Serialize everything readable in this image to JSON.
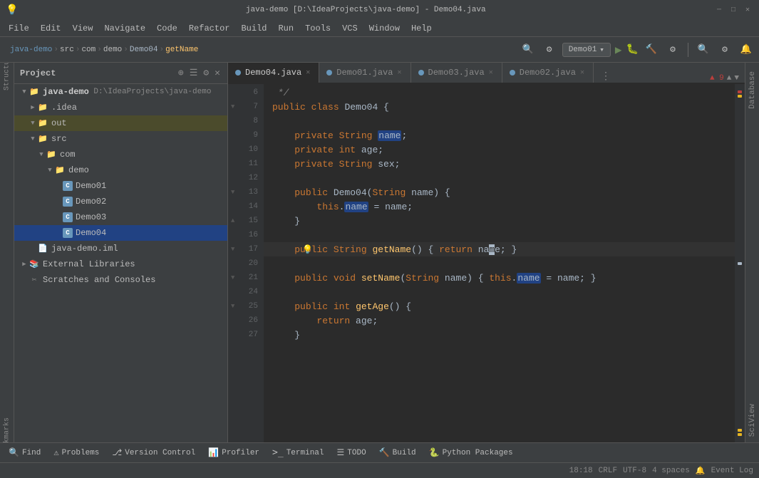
{
  "titleBar": {
    "title": "java-demo [D:\\IdeaProjects\\java-demo] - Demo04.java",
    "minBtn": "─",
    "maxBtn": "□",
    "closeBtn": "✕"
  },
  "menuBar": {
    "items": [
      "File",
      "Edit",
      "View",
      "Navigate",
      "Code",
      "Refactor",
      "Build",
      "Run",
      "Tools",
      "VCS",
      "Window",
      "Help"
    ]
  },
  "toolbar": {
    "projectName": "java-demo",
    "breadcrumb": {
      "parts": [
        "java-demo",
        "src",
        "com",
        "demo",
        "Demo04",
        "getName"
      ]
    },
    "runConfig": "Demo01"
  },
  "projectPanel": {
    "title": "Project",
    "tree": [
      {
        "indent": 0,
        "arrow": "▼",
        "icon": "📁",
        "label": "java-demo",
        "sublabel": "D:\\IdeaProjects\\java-demo",
        "type": "root"
      },
      {
        "indent": 1,
        "arrow": "▶",
        "icon": "📁",
        "label": ".idea",
        "type": "folder"
      },
      {
        "indent": 1,
        "arrow": "▼",
        "icon": "📁",
        "label": "out",
        "type": "folder-selected"
      },
      {
        "indent": 1,
        "arrow": "▼",
        "icon": "📁",
        "label": "src",
        "type": "src"
      },
      {
        "indent": 2,
        "arrow": "▼",
        "icon": "📁",
        "label": "com",
        "type": "folder"
      },
      {
        "indent": 3,
        "arrow": "▼",
        "icon": "📁",
        "label": "demo",
        "type": "folder"
      },
      {
        "indent": 4,
        "arrow": "",
        "icon": "C",
        "label": "Demo01",
        "type": "java"
      },
      {
        "indent": 4,
        "arrow": "",
        "icon": "C",
        "label": "Demo02",
        "type": "java"
      },
      {
        "indent": 4,
        "arrow": "",
        "icon": "C",
        "label": "Demo03",
        "type": "java"
      },
      {
        "indent": 4,
        "arrow": "",
        "icon": "C",
        "label": "Demo04",
        "type": "java"
      },
      {
        "indent": 1,
        "arrow": "",
        "icon": "📄",
        "label": "java-demo.iml",
        "type": "iml"
      },
      {
        "indent": 0,
        "arrow": "▶",
        "icon": "📚",
        "label": "External Libraries",
        "type": "lib"
      },
      {
        "indent": 0,
        "arrow": "",
        "icon": "✂",
        "label": "Scratches and Consoles",
        "type": "scratches"
      }
    ]
  },
  "tabs": [
    {
      "label": "Demo04.java",
      "active": true,
      "modified": false
    },
    {
      "label": "Demo01.java",
      "active": false,
      "modified": false
    },
    {
      "label": "Demo03.java",
      "active": false,
      "modified": false
    },
    {
      "label": "Demo02.java",
      "active": false,
      "modified": false
    }
  ],
  "codeLines": [
    {
      "num": 6,
      "content": " */",
      "type": "comment"
    },
    {
      "num": 7,
      "content": "public class Demo04 {",
      "type": "code"
    },
    {
      "num": 8,
      "content": "",
      "type": "code"
    },
    {
      "num": 9,
      "content": "    private String name;",
      "type": "code",
      "highlight": "name"
    },
    {
      "num": 10,
      "content": "    private int age;",
      "type": "code"
    },
    {
      "num": 11,
      "content": "    private String sex;",
      "type": "code"
    },
    {
      "num": 12,
      "content": "",
      "type": "code"
    },
    {
      "num": 13,
      "content": "    public Demo04(String name) {",
      "type": "code",
      "fold": true
    },
    {
      "num": 14,
      "content": "        this.name = name;",
      "type": "code"
    },
    {
      "num": 15,
      "content": "    }",
      "type": "code",
      "fold": true
    },
    {
      "num": 16,
      "content": "",
      "type": "code"
    },
    {
      "num": 17,
      "content": "    public String getName() { return name; }",
      "type": "code",
      "current": true,
      "hint": true,
      "fold": true
    },
    {
      "num": 20,
      "content": "",
      "type": "code"
    },
    {
      "num": 21,
      "content": "    public void setName(String name) { this.name = name; }",
      "type": "code",
      "fold": true
    },
    {
      "num": 24,
      "content": "",
      "type": "code"
    },
    {
      "num": 25,
      "content": "    public int getAge() {",
      "type": "code",
      "fold": true
    },
    {
      "num": 26,
      "content": "        return age;",
      "type": "code"
    },
    {
      "num": 27,
      "content": "    }",
      "type": "code"
    }
  ],
  "bottomTools": [
    {
      "icon": "🔍",
      "label": "Find"
    },
    {
      "icon": "⚠",
      "label": "Problems"
    },
    {
      "icon": "⎇",
      "label": "Version Control"
    },
    {
      "icon": "📊",
      "label": "Profiler"
    },
    {
      "icon": ">_",
      "label": "Terminal"
    },
    {
      "icon": "≡",
      "label": "TODO"
    },
    {
      "icon": "🔨",
      "label": "Build"
    },
    {
      "icon": "🐍",
      "label": "Python Packages"
    }
  ],
  "statusBar": {
    "position": "18:18",
    "lineEnding": "CRLF",
    "encoding": "UTF-8",
    "indent": "4 spaces",
    "rightItems": [
      "🔔",
      "Event Log"
    ]
  },
  "errorCount": "▲ 9",
  "rightLabels": [
    "Database",
    "SciView"
  ]
}
